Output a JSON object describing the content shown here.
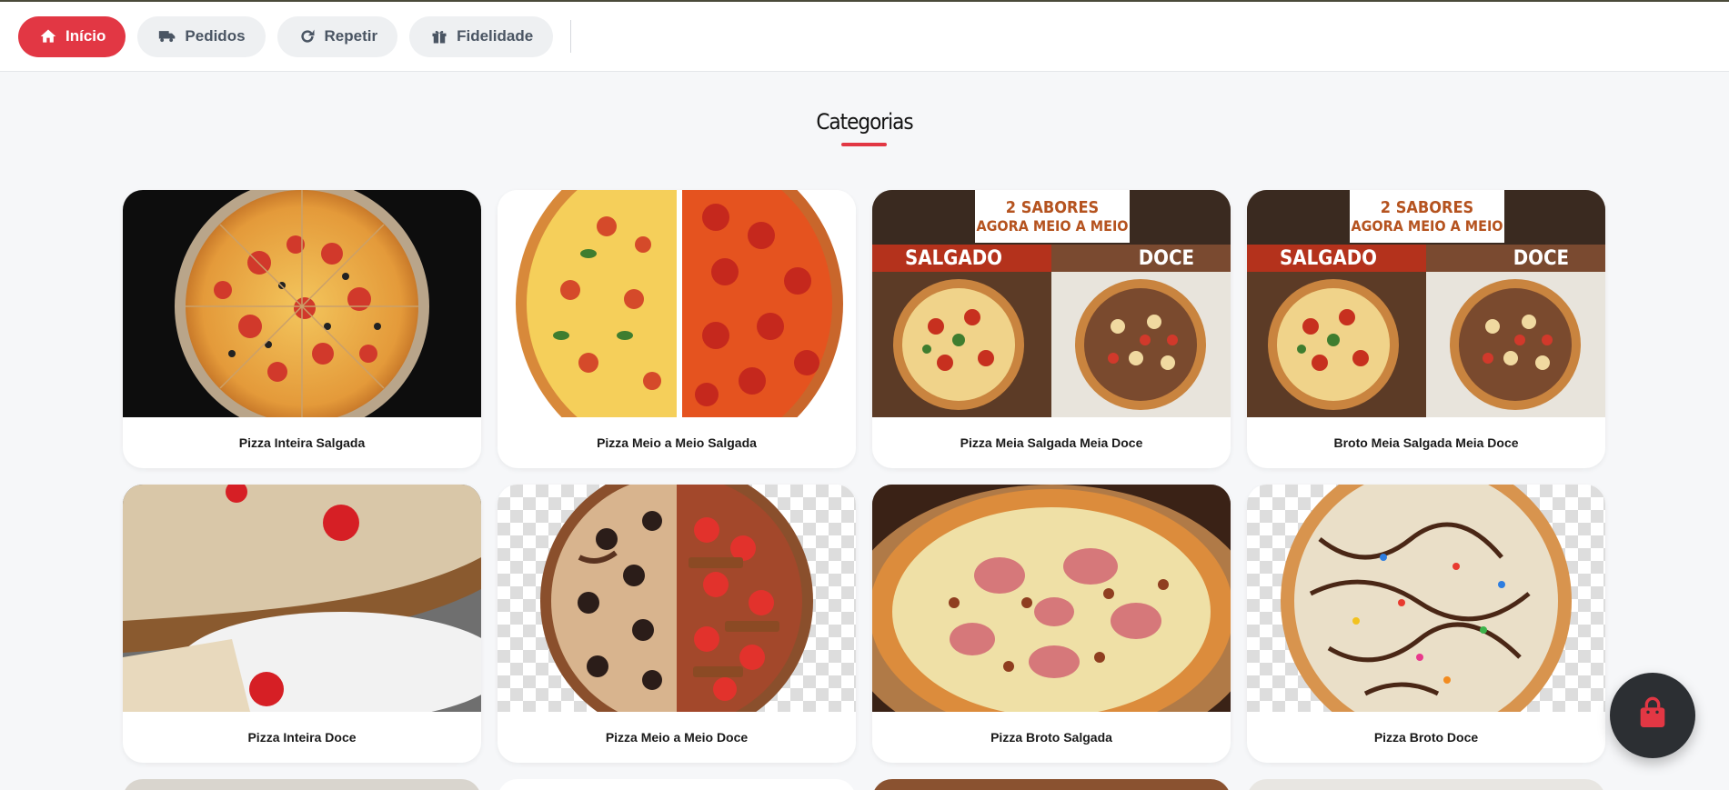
{
  "nav": {
    "items": [
      {
        "label": "Início",
        "icon": "home-icon",
        "active": true
      },
      {
        "label": "Pedidos",
        "icon": "truck-icon",
        "active": false
      },
      {
        "label": "Repetir",
        "icon": "redo-icon",
        "active": false
      },
      {
        "label": "Fidelidade",
        "icon": "gift-icon",
        "active": false
      }
    ]
  },
  "section": {
    "title": "Categorias"
  },
  "categories": [
    {
      "label": "Pizza Inteira Salgada"
    },
    {
      "label": "Pizza Meio a Meio Salgada"
    },
    {
      "label": "Pizza Meia Salgada Meia Doce",
      "banner": {
        "line1": "2 SABORES",
        "line2": "AGORA MEIO A MEIO",
        "left": "SALGADO",
        "right": "DOCE"
      }
    },
    {
      "label": "Broto Meia Salgada Meia Doce",
      "banner": {
        "line1": "2 SABORES",
        "line2": "AGORA MEIO A MEIO",
        "left": "SALGADO",
        "right": "DOCE"
      }
    },
    {
      "label": "Pizza Inteira Doce"
    },
    {
      "label": "Pizza Meio a Meio Doce"
    },
    {
      "label": "Pizza Broto Salgada"
    },
    {
      "label": "Pizza Broto Doce"
    }
  ],
  "colors": {
    "accent": "#e23744",
    "fab": "#2c2f33"
  },
  "cart": {
    "icon": "shopping-bag-icon"
  }
}
